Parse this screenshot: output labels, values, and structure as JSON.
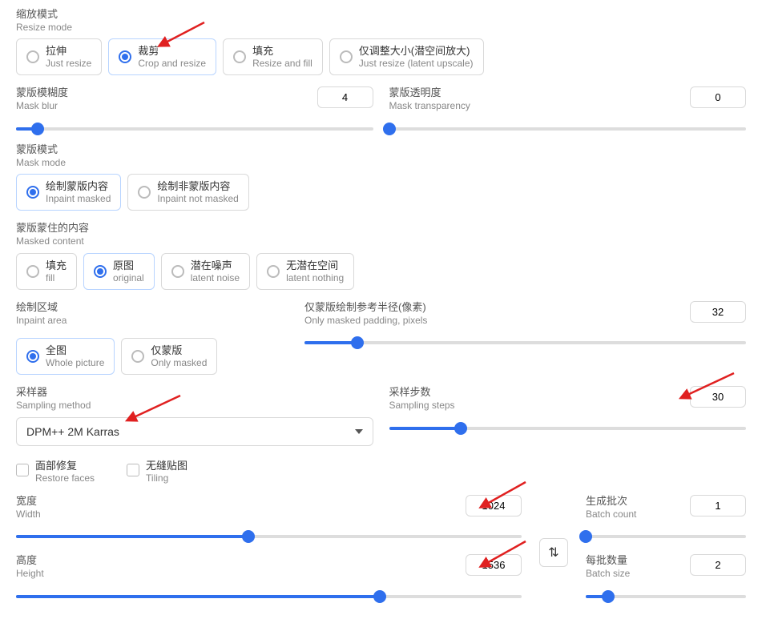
{
  "resize_mode": {
    "label_cn": "缩放模式",
    "label_en": "Resize mode",
    "options": [
      {
        "cn": "拉伸",
        "en": "Just resize"
      },
      {
        "cn": "裁剪",
        "en": "Crop and resize"
      },
      {
        "cn": "填充",
        "en": "Resize and fill"
      },
      {
        "cn": "仅调整大小(潜空间放大)",
        "en": "Just resize (latent upscale)"
      }
    ],
    "selected": 1
  },
  "mask_blur": {
    "label_cn": "蒙版模糊度",
    "label_en": "Mask blur",
    "value": "4",
    "pct": 6
  },
  "mask_transparency": {
    "label_cn": "蒙版透明度",
    "label_en": "Mask transparency",
    "value": "0",
    "pct": 0
  },
  "mask_mode": {
    "label_cn": "蒙版模式",
    "label_en": "Mask mode",
    "options": [
      {
        "cn": "绘制蒙版内容",
        "en": "Inpaint masked"
      },
      {
        "cn": "绘制非蒙版内容",
        "en": "Inpaint not masked"
      }
    ],
    "selected": 0
  },
  "masked_content": {
    "label_cn": "蒙版蒙住的内容",
    "label_en": "Masked content",
    "options": [
      {
        "cn": "填充",
        "en": "fill"
      },
      {
        "cn": "原图",
        "en": "original"
      },
      {
        "cn": "潜在噪声",
        "en": "latent noise"
      },
      {
        "cn": "无潜在空间",
        "en": "latent nothing"
      }
    ],
    "selected": 1
  },
  "inpaint_area": {
    "label_cn": "绘制区域",
    "label_en": "Inpaint area",
    "options": [
      {
        "cn": "全图",
        "en": "Whole picture"
      },
      {
        "cn": "仅蒙版",
        "en": "Only masked"
      }
    ],
    "selected": 0
  },
  "only_masked_padding": {
    "label_cn": "仅蒙版绘制参考半径(像素)",
    "label_en": "Only masked padding, pixels",
    "value": "32",
    "pct": 12
  },
  "sampling_method": {
    "label_cn": "采样器",
    "label_en": "Sampling method",
    "value": "DPM++ 2M Karras"
  },
  "sampling_steps": {
    "label_cn": "采样步数",
    "label_en": "Sampling steps",
    "value": "30",
    "pct": 20
  },
  "restore_faces": {
    "cn": "面部修复",
    "en": "Restore faces"
  },
  "tiling": {
    "cn": "无缝贴图",
    "en": "Tiling"
  },
  "width": {
    "label_cn": "宽度",
    "label_en": "Width",
    "value": "1024",
    "pct": 46
  },
  "height": {
    "label_cn": "高度",
    "label_en": "Height",
    "value": "1536",
    "pct": 72
  },
  "batch_count": {
    "label_cn": "生成批次",
    "label_en": "Batch count",
    "value": "1",
    "pct": 0
  },
  "batch_size": {
    "label_cn": "每批数量",
    "label_en": "Batch size",
    "value": "2",
    "pct": 14
  },
  "swap_icon": "⇅"
}
